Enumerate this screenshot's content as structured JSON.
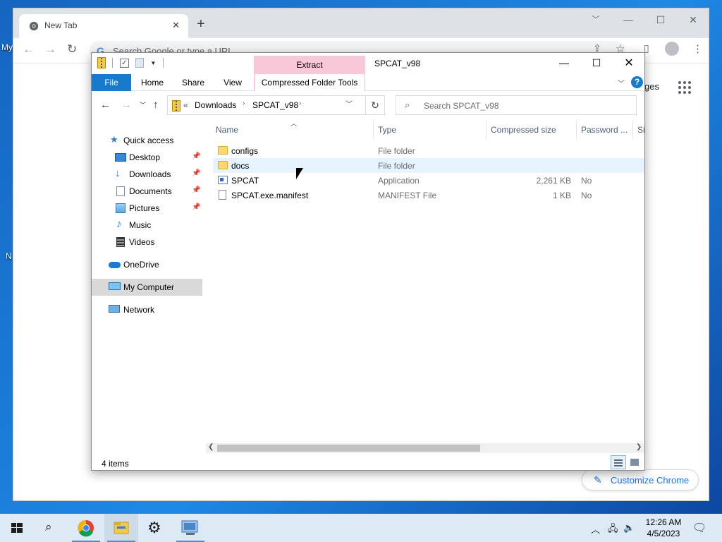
{
  "desktop": {
    "labels": [
      "My",
      "N"
    ]
  },
  "chrome": {
    "tab_title": "New Tab",
    "omnibox_placeholder": "Search Google or type a URL",
    "ntp_link": "ges",
    "customize_label": "Customize Chrome"
  },
  "explorer": {
    "ribbon_context_group": "Extract",
    "window_title": "SPCAT_v98",
    "ribbon_tabs": [
      "File",
      "Home",
      "Share",
      "View",
      "Compressed Folder Tools"
    ],
    "address": {
      "prefix": "«",
      "crumbs": [
        "Downloads",
        "SPCAT_v98"
      ]
    },
    "search_placeholder": "Search SPCAT_v98",
    "nav": [
      {
        "label": "Quick access",
        "icon": "star-icon",
        "pinned": false
      },
      {
        "label": "Desktop",
        "icon": "desktop-icon",
        "pinned": true
      },
      {
        "label": "Downloads",
        "icon": "download-arrow-icon",
        "pinned": true
      },
      {
        "label": "Documents",
        "icon": "documents-icon",
        "pinned": true
      },
      {
        "label": "Pictures",
        "icon": "pictures-icon",
        "pinned": true
      },
      {
        "label": "Music",
        "icon": "music-note-icon",
        "pinned": false
      },
      {
        "label": "Videos",
        "icon": "film-icon",
        "pinned": false
      },
      {
        "label": "OneDrive",
        "icon": "cloud-icon",
        "pinned": false
      },
      {
        "label": "My Computer",
        "icon": "computer-icon",
        "pinned": false,
        "selected": true
      },
      {
        "label": "Network",
        "icon": "network-icon",
        "pinned": false
      }
    ],
    "columns": [
      "Name",
      "Type",
      "Compressed size",
      "Password ...",
      "Si"
    ],
    "files": [
      {
        "name": "configs",
        "type": "File folder",
        "size": "",
        "password": "",
        "icon": "folder-icon"
      },
      {
        "name": "docs",
        "type": "File folder",
        "size": "",
        "password": "",
        "icon": "folder-icon",
        "hover": true
      },
      {
        "name": "SPCAT",
        "type": "Application",
        "size": "2,261 KB",
        "password": "No",
        "icon": "application-icon"
      },
      {
        "name": "SPCAT.exe.manifest",
        "type": "MANIFEST File",
        "size": "1 KB",
        "password": "No",
        "icon": "file-icon"
      }
    ],
    "status": "4 items"
  },
  "taskbar": {
    "time": "12:26 AM",
    "date": "4/5/2023"
  },
  "colors": {
    "file_tab": "#1979ca",
    "context_tab": "#f9c8d8",
    "selection": "#d9d9d9",
    "hover_row": "#e5f3ff"
  }
}
